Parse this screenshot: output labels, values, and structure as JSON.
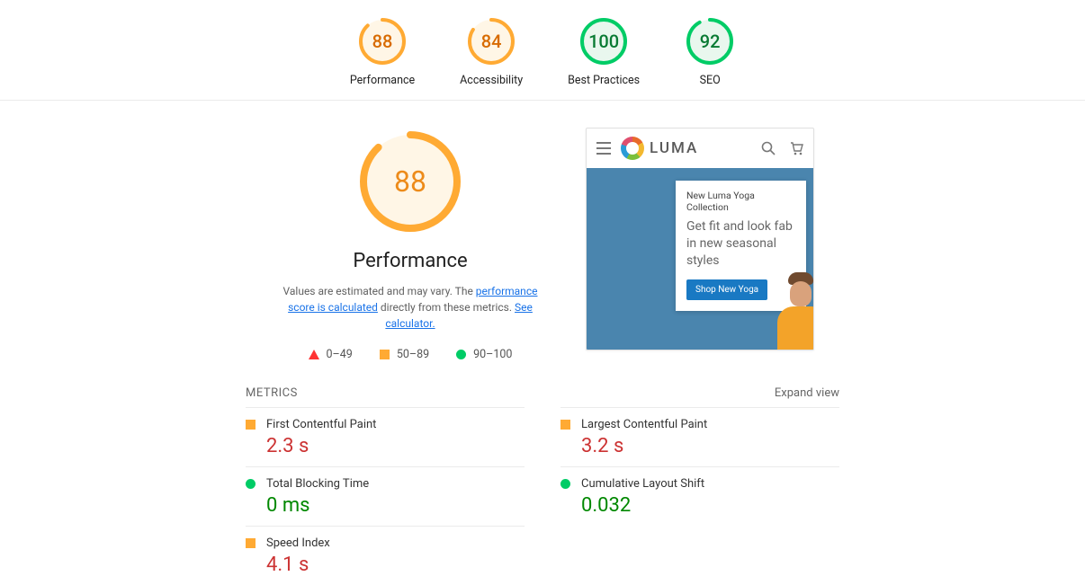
{
  "topScores": [
    {
      "label": "Performance",
      "value": 88,
      "color": "#fa3",
      "fill": "#fff6e6",
      "text": "#d86b00"
    },
    {
      "label": "Accessibility",
      "value": 84,
      "color": "#fa3",
      "fill": "#fff6e6",
      "text": "#d86b00"
    },
    {
      "label": "Best Practices",
      "value": 100,
      "color": "#0c6",
      "fill": "#e9f7ee",
      "text": "#097a33"
    },
    {
      "label": "SEO",
      "value": 92,
      "color": "#0c6",
      "fill": "#e9f7ee",
      "text": "#097a33"
    }
  ],
  "big": {
    "label": "Performance",
    "value": 88
  },
  "desc": {
    "pre": "Values are estimated and may vary. The ",
    "link1": "performance score is calculated",
    "mid": " directly from these metrics. ",
    "link2": "See calculator."
  },
  "legend": {
    "a": "0–49",
    "b": "50–89",
    "c": "90–100"
  },
  "preview": {
    "brand": "LUMA",
    "headline": "New Luma Yoga Collection",
    "sub": "Get fit and look fab in new seasonal styles",
    "cta": "Shop New Yoga"
  },
  "metricsTitle": "METRICS",
  "expand": "Expand view",
  "metrics": [
    {
      "name": "First Contentful Paint",
      "value": "2.3 s",
      "status": "avg"
    },
    {
      "name": "Largest Contentful Paint",
      "value": "3.2 s",
      "status": "avg"
    },
    {
      "name": "Total Blocking Time",
      "value": "0 ms",
      "status": "good"
    },
    {
      "name": "Cumulative Layout Shift",
      "value": "0.032",
      "status": "good"
    },
    {
      "name": "Speed Index",
      "value": "4.1 s",
      "status": "avg"
    }
  ]
}
